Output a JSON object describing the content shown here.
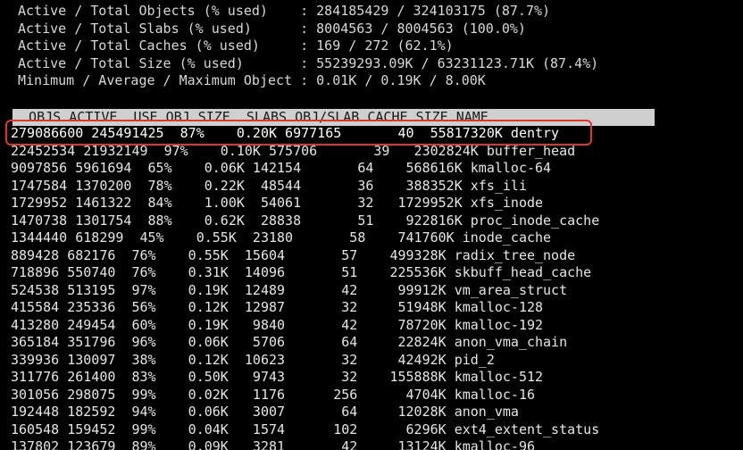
{
  "summary": [
    "Active / Total Objects (% used)    : 284185429 / 324103175 (87.7%)",
    "Active / Total Slabs (% used)      : 8004563 / 8004563 (100.0%)",
    "Active / Total Caches (% used)     : 169 / 272 (62.1%)",
    "Active / Total Size (% used)       : 55239293.09K / 63231123.71K (87.4%)",
    "Minimum / Average / Maximum Object : 0.01K / 0.19K / 8.00K"
  ],
  "table_header": "  OBJS ACTIVE  USE OBJ SIZE  SLABS OBJ/SLAB CACHE SIZE NAME",
  "rows": [
    "279086600 245491425  87%    0.20K 6977165       40  55817320K dentry",
    "22452534 21932149  97%    0.10K 575706       39   2302824K buffer_head",
    "9097856 5961694  65%    0.06K 142154       64    568616K kmalloc-64",
    "1747584 1370200  78%    0.22K  48544       36    388352K xfs_ili",
    "1729952 1461322  84%    1.00K  54061       32   1729952K xfs_inode",
    "1470738 1301754  88%    0.62K  28838       51    922816K proc_inode_cache",
    "1344440 618299  45%    0.55K  23180       58    741760K inode_cache",
    "889428 682176  76%    0.55K  15604       57    499328K radix_tree_node",
    "718896 550740  76%    0.31K  14096       51    225536K skbuff_head_cache",
    "524538 513195  97%    0.19K  12489       42     99912K vm_area_struct",
    "415584 235336  56%    0.12K  12987       32     51948K kmalloc-128",
    "413280 249454  60%    0.19K   9840       42     78720K kmalloc-192",
    "365184 351796  96%    0.06K   5706       64     22824K anon_vma_chain",
    "339936 130097  38%    0.12K  10623       32     42492K pid_2",
    "311776 261400  83%    0.50K   9743       32    155888K kmalloc-512",
    "301056 298075  99%    0.02K   1176      256      4704K kmalloc-16",
    "192448 182592  94%    0.06K   3007       64     12028K anon_vma",
    "160548 159452  99%    0.04K   1574      102      6296K ext4_extent_status",
    "137802 123679  89%    0.09K   3281       42     13124K kmalloc-96"
  ],
  "colors": {
    "background": "#000000",
    "text": "#e6e6e6",
    "header_bar": "#cfcfcf",
    "highlight": "#e0352b"
  }
}
